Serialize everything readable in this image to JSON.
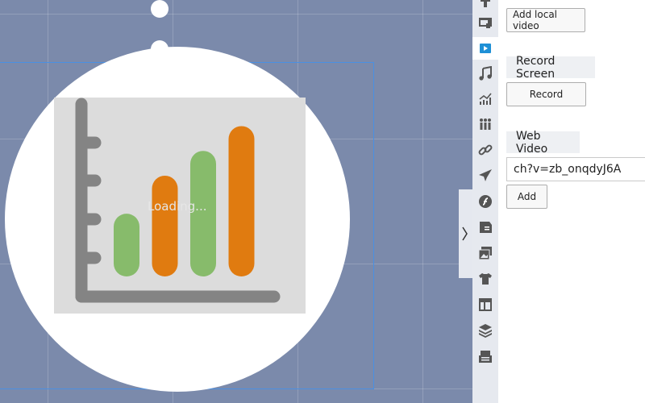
{
  "canvas": {
    "loading_text": "Loading..."
  },
  "chart_image": {
    "bars": [
      {
        "color": "#87bb6b",
        "value": 0.38
      },
      {
        "color": "#e07b10",
        "value": 0.61
      },
      {
        "color": "#87bb6b",
        "value": 0.76
      },
      {
        "color": "#e07b10",
        "value": 0.91
      }
    ],
    "axis_color": "#848484",
    "background": "#dcdcdc"
  },
  "toolbar": {
    "icons": [
      "text-icon",
      "presenter-icon",
      "video-icon",
      "music-icon",
      "chart-icon",
      "people-icon",
      "link-icon",
      "plane-icon",
      "flash-icon",
      "document-icon",
      "gallery-icon",
      "shirt-icon",
      "layout-icon",
      "layers-icon",
      "inbox-icon"
    ],
    "active": "video-icon"
  },
  "panel": {
    "add_local_video": "Add local video",
    "record_screen_label": "Record Screen",
    "record_button": "Record",
    "web_video_label": "Web Video",
    "url_value": "ch?v=zb_onqdyJ6A",
    "add_button": "Add"
  },
  "colors": {
    "accent": "#1e90d6",
    "canvas": "#7b8aab",
    "toolbar": "#e6e9ef"
  }
}
